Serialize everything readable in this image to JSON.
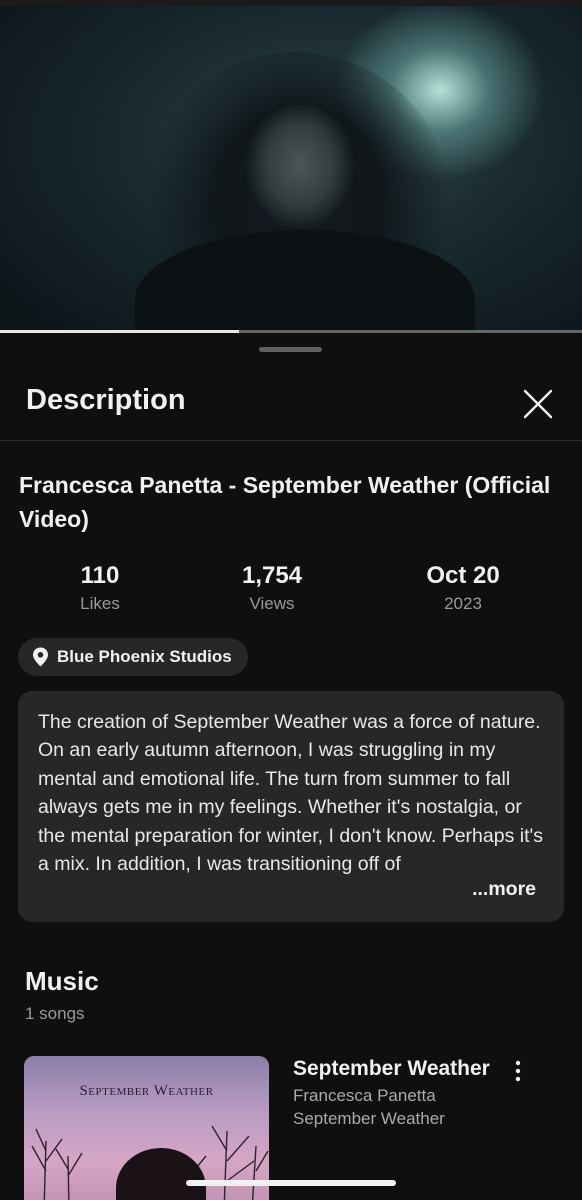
{
  "video_player": {
    "progress": 0.41,
    "alt": ""
  },
  "description_panel": {
    "title": "Description",
    "close_icon": "close-icon"
  },
  "video": {
    "title": "Francesca Panetta - September Weather (Official Video)",
    "stats": [
      {
        "value": "110",
        "label": "Likes"
      },
      {
        "value": "1,754",
        "label": "Views"
      },
      {
        "value": "Oct 20",
        "label": "2023"
      }
    ],
    "location": {
      "icon": "location-pin-icon",
      "label": "Blue Phoenix Studios"
    },
    "description": "The creation of September Weather was a force of nature. On an early autumn afternoon, I was struggling in my mental and emotional life. The turn from summer to fall always gets me in my feelings. Whether it's nostalgia, or the mental preparation for winter, I don't know. Perhaps it's a mix. In addition, I was transitioning off of",
    "more_label": "...more"
  },
  "music": {
    "heading": "Music",
    "count": "1 songs",
    "songs": [
      {
        "art_text": "September Weather",
        "title": "September Weather",
        "artist": "Francesca Panetta",
        "album": "September Weather",
        "menu_icon": "more-vert-icon"
      }
    ]
  },
  "colors": {
    "background": "#0f0f0f",
    "card": "#272727",
    "text_primary": "#f1f1f1",
    "text_secondary": "#9a9a9a"
  }
}
